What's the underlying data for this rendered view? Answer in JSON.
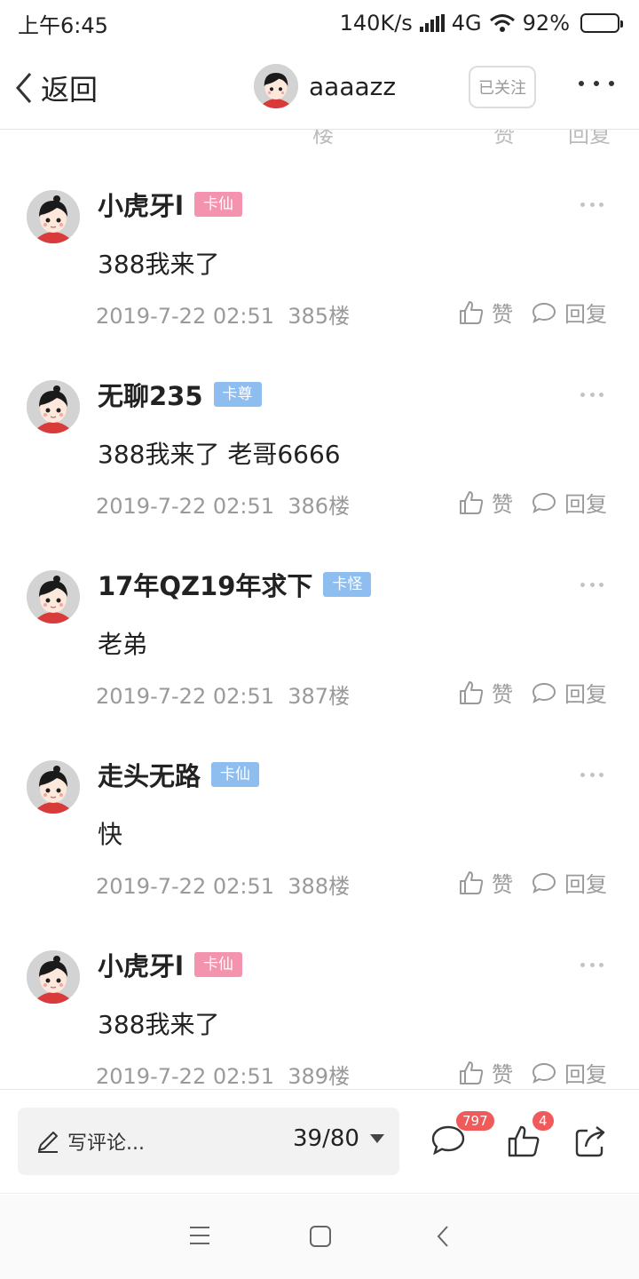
{
  "status": {
    "time": "上午6:45",
    "speed": "140K/s",
    "network": "4G",
    "battery": "92%",
    "battery_level": 0.92
  },
  "header": {
    "back_label": "返回",
    "username": "aaaazz",
    "follow_label": "已关注"
  },
  "partial_row": {
    "floor_tail": "楼",
    "like": "赞",
    "reply": "回复"
  },
  "comments": [
    {
      "username": "小虎牙l",
      "badge": "卡仙",
      "badge_color": "#f493ad",
      "content": "388我来了",
      "time": "2019-7-22 02:51",
      "floor": "385楼",
      "like": "赞",
      "reply": "回复"
    },
    {
      "username": "无聊235",
      "badge": "卡尊",
      "badge_color": "#8ebef0",
      "content": "388我来了 老哥6666",
      "time": "2019-7-22 02:51",
      "floor": "386楼",
      "like": "赞",
      "reply": "回复"
    },
    {
      "username": "17年QZ19年求下",
      "badge": "卡怪",
      "badge_color": "#8ebef0",
      "content": "老弟",
      "time": "2019-7-22 02:51",
      "floor": "387楼",
      "like": "赞",
      "reply": "回复"
    },
    {
      "username": "走头无路",
      "badge": "卡仙",
      "badge_color": "#8ebef0",
      "content": "快",
      "time": "2019-7-22 02:51",
      "floor": "388楼",
      "like": "赞",
      "reply": "回复"
    },
    {
      "username": "小虎牙l",
      "badge": "卡仙",
      "badge_color": "#f493ad",
      "content": "388我来了",
      "time": "2019-7-22 02:51",
      "floor": "389楼",
      "like": "赞",
      "reply": "回复"
    }
  ],
  "bottom": {
    "write_placeholder": "写评论...",
    "page": "39/80",
    "comment_count": "797",
    "like_count": "4"
  },
  "icons": {
    "edit": "pencil-icon",
    "comment": "comment-bubble-icon",
    "like": "thumbs-up-icon",
    "share": "share-icon"
  }
}
